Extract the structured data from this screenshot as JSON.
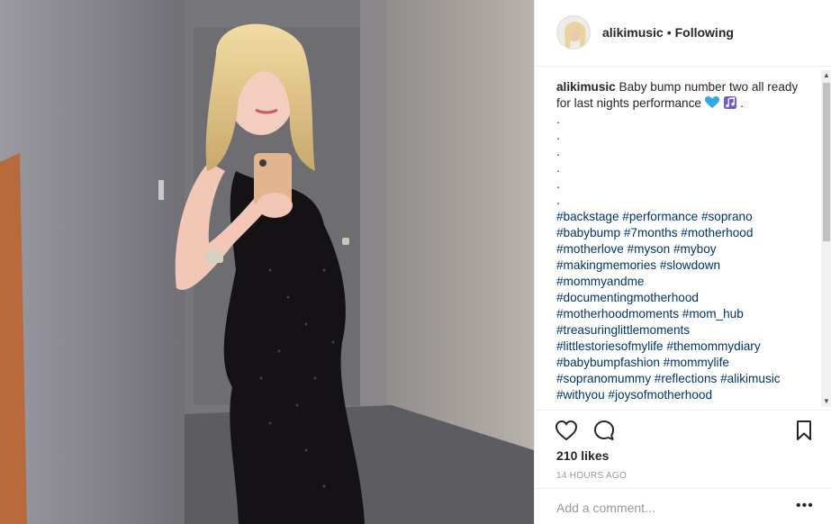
{
  "post": {
    "username": "alikimusic",
    "separator": "•",
    "follow_status": "Following"
  },
  "caption": {
    "username": "alikimusic",
    "text": "Baby bump number two all ready for last nights performance",
    "end_period": ".",
    "dots": [
      ".",
      ".",
      ".",
      ".",
      ".",
      "."
    ],
    "hashtag_lines": [
      "#backstage #performance #soprano",
      "#babybump #7months #motherhood",
      "#motherlove #myson #myboy",
      "#makingmemories #slowdown",
      "#mommyandme",
      "#documentingmotherhood",
      "#motherhoodmoments #mom_hub",
      "#treasuringlittlemoments",
      "#littlestoriesofmylife #themommydiary",
      "#babybumpfashion #mommylife",
      "#sopranomummy #reflections #alikimusic",
      "#withyou #joysofmotherhood"
    ],
    "emojis": [
      "blue-heart-icon",
      "musical-notes-icon"
    ]
  },
  "likes": "210 likes",
  "timestamp": "14 HOURS AGO",
  "comment": {
    "placeholder": "Add a comment...",
    "more_label": "•••"
  },
  "icons": {
    "like": "heart-outline-icon",
    "comment": "speech-bubble-icon",
    "save": "bookmark-icon",
    "scroll_up": "scroll-up-arrow-icon",
    "scroll_down": "scroll-down-arrow-icon"
  },
  "colors": {
    "hashtag": "#003569",
    "text": "#262626",
    "muted": "#999999",
    "border": "#efefef",
    "blue_heart": "#2fa8e5",
    "music_notes": "#6b5bd6"
  }
}
